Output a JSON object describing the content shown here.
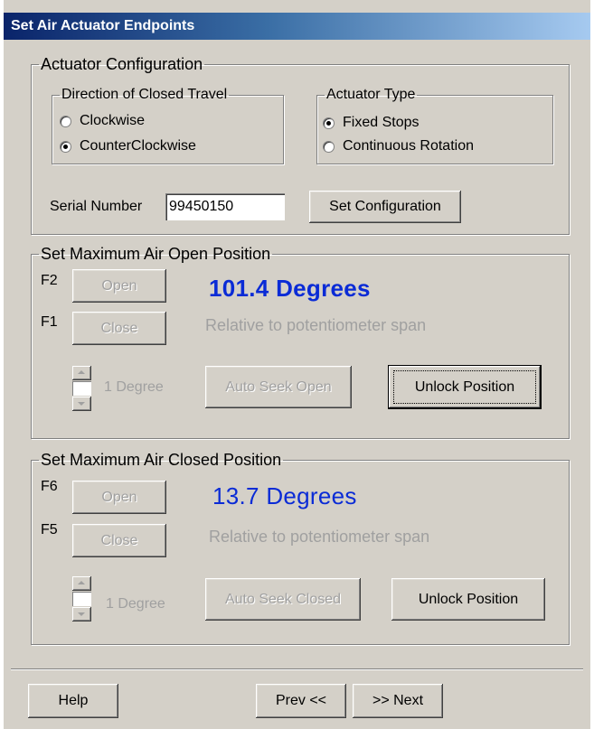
{
  "title": "Set Air Actuator Endpoints",
  "config": {
    "legend": "Actuator Configuration",
    "direction": {
      "legend": "Direction of Closed Travel",
      "options": [
        {
          "label": "Clockwise",
          "checked": false
        },
        {
          "label": "CounterClockwise",
          "checked": true
        }
      ]
    },
    "actuator_type": {
      "legend": "Actuator Type",
      "options": [
        {
          "label": "Fixed Stops",
          "checked": true
        },
        {
          "label": "Continuous Rotation",
          "checked": false
        }
      ]
    },
    "serial_label": "Serial Number",
    "serial_value": "99450150",
    "set_button": "Set Configuration"
  },
  "open_section": {
    "legend": "Set Maximum Air Open Position",
    "fkey_open": "F2",
    "fkey_close": "F1",
    "open_button": "Open",
    "close_button": "Close",
    "degrees": "101.4 Degrees",
    "relative": "Relative to potentiometer span",
    "step_label": "1 Degree",
    "auto_seek": "Auto Seek Open",
    "unlock": "Unlock Position"
  },
  "closed_section": {
    "legend": "Set Maximum Air Closed Position",
    "fkey_open": "F6",
    "fkey_close": "F5",
    "open_button": "Open",
    "close_button": "Close",
    "degrees": "13.7  Degrees",
    "relative": "Relative to potentiometer span",
    "step_label": "1 Degree",
    "auto_seek": "Auto Seek Closed",
    "unlock": "Unlock Position"
  },
  "footer": {
    "help": "Help",
    "prev": "Prev <<",
    "next": ">> Next"
  },
  "colors": {
    "degrees_text": "#0a2bd6",
    "dialog_bg": "#d4d0c8",
    "disabled_text": "#a0a0a0"
  }
}
